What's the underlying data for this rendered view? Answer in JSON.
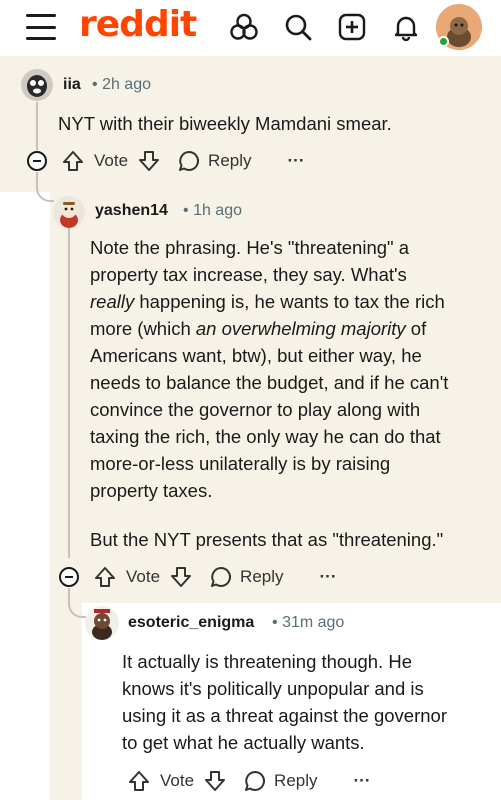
{
  "app": {
    "logo_text": "reddit",
    "brand_color": "#ff4500",
    "icons": [
      "menu-icon",
      "popular-icon",
      "search-icon",
      "create-post-icon",
      "notifications-icon",
      "user-avatar"
    ]
  },
  "comments": [
    {
      "author": "iia",
      "time": "2h ago",
      "body": [
        "NYT with their biweekly Mamdani smear."
      ]
    },
    {
      "author": "yashen14",
      "time": "1h ago",
      "body_lines": [
        "Note the phrasing. He's \"threatening\" a",
        "property tax increase, they say. What's",
        "really happening is, he wants to tax the rich",
        "more (which an overwhelming majority of",
        "Americans want, btw), but either way, he",
        "needs to balance the budget, and if he can't",
        "convince the governor to play along with",
        "taxing the rich, the only way he can do that",
        "more-or-less unilaterally is by raising",
        "property taxes."
      ],
      "body_p2": "But the NYT presents that as \"threatening.\""
    },
    {
      "author": "esoteric_enigma",
      "time": "31m ago",
      "body_lines": [
        "It actually is threatening though. He",
        "knows it's politically unpopular and is",
        "using it as a threat against the governor",
        "to get what he actually wants."
      ]
    }
  ],
  "actions": {
    "vote_label": "Vote",
    "reply_label": "Reply",
    "more_label": "···",
    "separator": "•"
  }
}
